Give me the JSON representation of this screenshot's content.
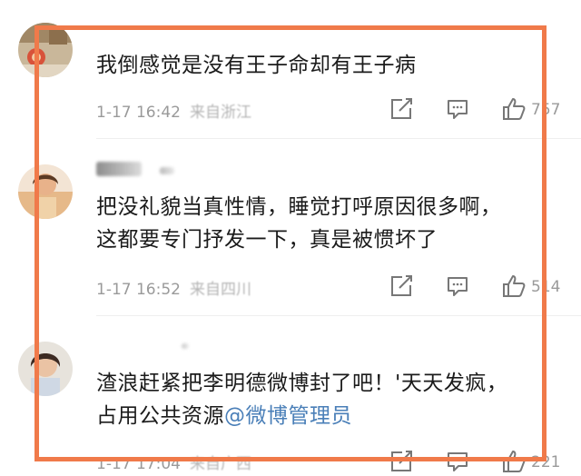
{
  "comments": [
    {
      "text_lines": [
        "我倒感觉是没有王子命却有王子病"
      ],
      "time": "1-17 16:42",
      "location": "来自浙江",
      "likes": "757"
    },
    {
      "text_lines": [
        "把没礼貌当真性情，睡觉打呼原因很多啊，",
        "这都要专门抒发一下，真是被惯坏了"
      ],
      "time": "1-17 16:52",
      "location": "来自四川",
      "likes": "514"
    },
    {
      "text_lines": [
        "渣浪赶紧把李明德微博封了吧！'天天发疯，"
      ],
      "text_line2_prefix": "占用公共资源",
      "mention": "@微博管理员",
      "time": "1-17 17:04",
      "location": "来自广西",
      "likes": "221"
    }
  ],
  "icons": {
    "share": "share-icon",
    "comment": "comment-icon",
    "like": "thumbs-up-icon"
  },
  "colors": {
    "highlight_border": "#f07a4a",
    "mention": "#4a7fb8",
    "meta_text": "#9a9a9a"
  }
}
